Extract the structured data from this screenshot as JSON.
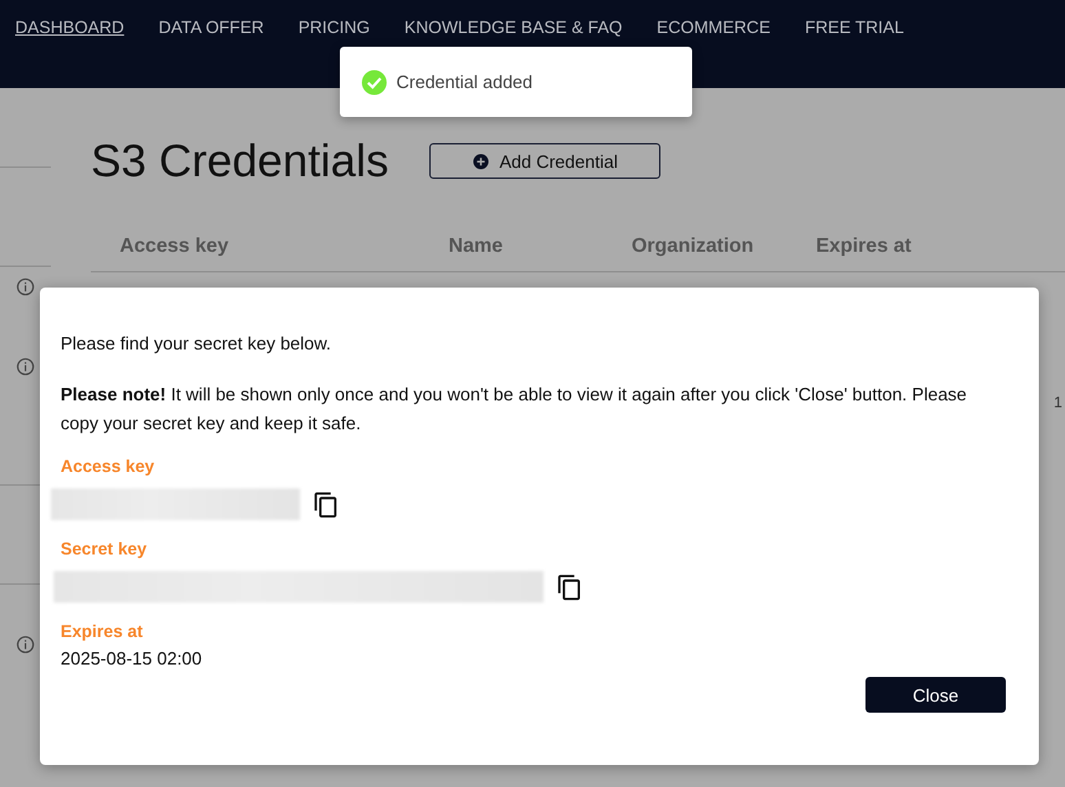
{
  "nav": [
    {
      "label": "DASHBOARD",
      "selected": true
    },
    {
      "label": "DATA OFFER",
      "selected": false
    },
    {
      "label": "PRICING",
      "selected": false
    },
    {
      "label": "KNOWLEDGE BASE & FAQ",
      "selected": false
    },
    {
      "label": "ECOMMERCE",
      "selected": false
    },
    {
      "label": "FREE TRIAL",
      "selected": false
    }
  ],
  "toast": {
    "text": "Credential added",
    "kind": "success"
  },
  "page": {
    "title": "S3 Credentials",
    "add_button": "Add Credential",
    "columns": [
      "Access key",
      "Name",
      "Organization",
      "Expires at"
    ],
    "rows": [
      {
        "side_value": "1"
      }
    ]
  },
  "modal": {
    "intro": "Please find your secret key below.",
    "note": "**Please note!** It will be shown only once and you won't be able to view it again after you click 'Close' button. Please copy your secret key and keep it safe.",
    "fields": [
      {
        "label": "Access key",
        "kind": "blurred"
      },
      {
        "label": "Secret key",
        "kind": "blurred"
      },
      {
        "label": "Expires at",
        "kind": "text",
        "value": "2025-08-15 02:00"
      }
    ],
    "close": "Close"
  }
}
